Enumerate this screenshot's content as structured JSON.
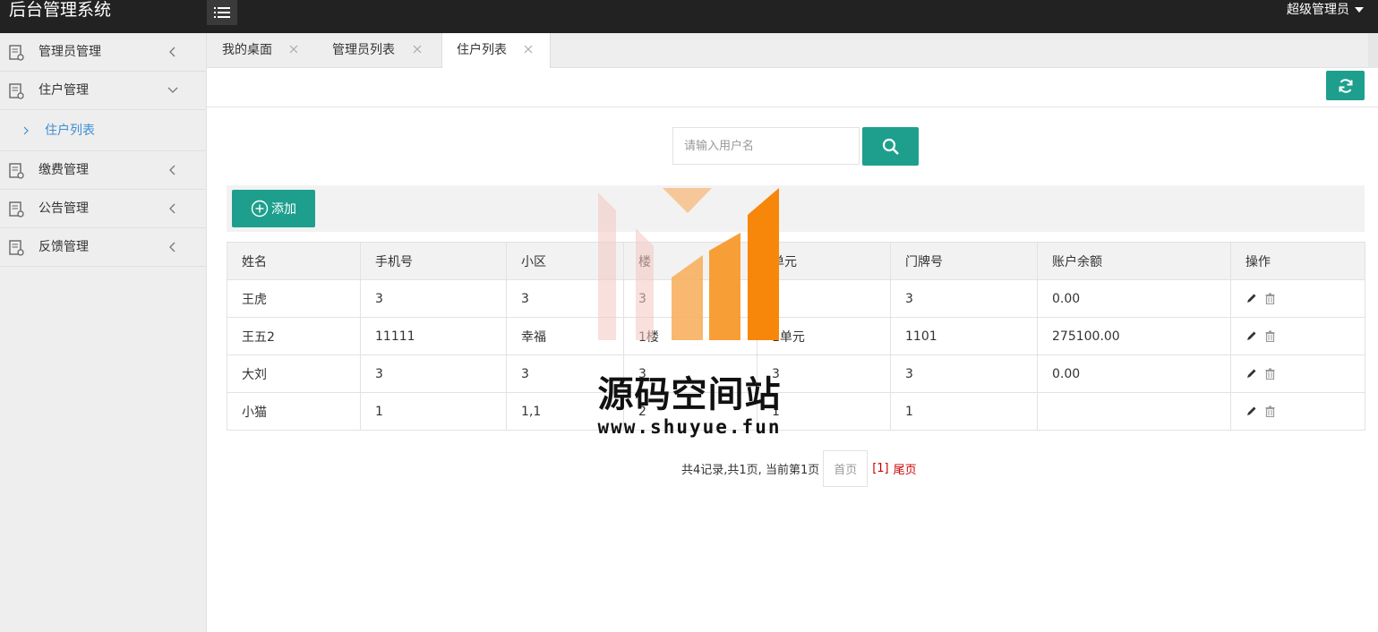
{
  "app": {
    "title": "后台管理系统",
    "user": "超级管理员"
  },
  "sidebar": {
    "items": [
      {
        "label": "管理员管理"
      },
      {
        "label": "住户管理",
        "expanded": true,
        "children": [
          {
            "label": "住户列表"
          }
        ]
      },
      {
        "label": "缴费管理"
      },
      {
        "label": "公告管理"
      },
      {
        "label": "反馈管理"
      }
    ]
  },
  "tabs": [
    {
      "label": "我的桌面"
    },
    {
      "label": "管理员列表"
    },
    {
      "label": "住户列表",
      "active": true
    }
  ],
  "search": {
    "placeholder": "请输入用户名"
  },
  "toolbar": {
    "add_label": "添加"
  },
  "table": {
    "headers": [
      "姓名",
      "手机号",
      "小区",
      "楼",
      "单元",
      "门牌号",
      "账户余额",
      "操作"
    ],
    "rows": [
      [
        "王虎",
        "3",
        "3",
        "3",
        "3",
        "3",
        "0.00"
      ],
      [
        "王五2",
        "11111",
        "幸福",
        "1楼",
        "1单元",
        "1101",
        "275100.00"
      ],
      [
        "大刘",
        "3",
        "3",
        "3",
        "3",
        "3",
        "0.00"
      ],
      [
        "小猫",
        "1",
        "1,1",
        "2",
        "1",
        "1",
        ""
      ]
    ]
  },
  "pagination": {
    "summary": "共4记录,共1页, 当前第1页",
    "first": "首页",
    "current": "[1]",
    "last": "尾页"
  },
  "watermark": {
    "text": "源码空间站",
    "url": "www.shuyue.fun"
  },
  "colors": {
    "accent": "#1e9f8e",
    "topbar": "#222222",
    "sidebar": "#eeeeee",
    "link": "#3b8fd4",
    "pager_active": "#cc0000"
  },
  "icons": {
    "menu": "list-icon",
    "nav": "document-icon",
    "collapsed": "chevron-left-icon",
    "expanded": "chevron-down-icon",
    "refresh": "refresh-icon",
    "search": "search-icon",
    "add": "plus-circle-icon",
    "edit": "pencil-icon",
    "delete": "trash-icon"
  }
}
